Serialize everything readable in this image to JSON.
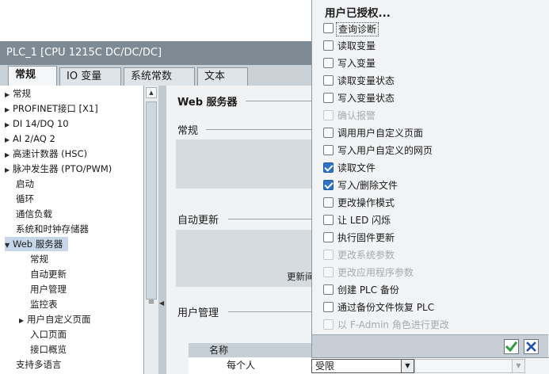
{
  "window": {
    "title": "PLC_1 [CPU 1215C DC/DC/DC]",
    "tabs": [
      "常规",
      "IO 变量",
      "系统常数",
      "文本"
    ]
  },
  "tree": {
    "items": [
      {
        "label": "常规",
        "arrow": "▶"
      },
      {
        "label": "PROFINET接口 [X1]",
        "arrow": "▶"
      },
      {
        "label": "DI 14/DQ 10",
        "arrow": "▶"
      },
      {
        "label": "AI 2/AQ 2",
        "arrow": "▶"
      },
      {
        "label": "高速计数器 (HSC)",
        "arrow": "▶"
      },
      {
        "label": "脉冲发生器 (PTO/PWM)",
        "arrow": "▶"
      },
      {
        "label": "启动",
        "arrow": ""
      },
      {
        "label": "循环",
        "arrow": ""
      },
      {
        "label": "通信负载",
        "arrow": ""
      },
      {
        "label": "系统和时钟存储器",
        "arrow": ""
      },
      {
        "label": "Web 服务器",
        "arrow": "▼"
      },
      {
        "label": "常规",
        "arrow": ""
      },
      {
        "label": "自动更新",
        "arrow": ""
      },
      {
        "label": "用户管理",
        "arrow": ""
      },
      {
        "label": "监控表",
        "arrow": ""
      },
      {
        "label": "用户自定义页面",
        "arrow": "▶"
      },
      {
        "label": "入口页面",
        "arrow": ""
      },
      {
        "label": "接口概览",
        "arrow": ""
      },
      {
        "label": "支持多语言",
        "arrow": ""
      }
    ]
  },
  "content": {
    "section_title": "Web 服务器",
    "general": "常规",
    "auto_update": "自动更新",
    "update_partial": "更新间",
    "user_management": "用户管理",
    "table_col_name": "名称",
    "table_row_name": "每个人"
  },
  "popup": {
    "title": "用户已授权...",
    "permissions": [
      {
        "label": "查询诊断",
        "checked": false,
        "disabled": false
      },
      {
        "label": "读取变量",
        "checked": false,
        "disabled": false
      },
      {
        "label": "写入变量",
        "checked": false,
        "disabled": false
      },
      {
        "label": "读取变量状态",
        "checked": false,
        "disabled": false
      },
      {
        "label": "写入变量状态",
        "checked": false,
        "disabled": false
      },
      {
        "label": "确认报警",
        "checked": false,
        "disabled": true
      },
      {
        "label": "调用用户自定义页面",
        "checked": false,
        "disabled": false
      },
      {
        "label": "写入用户自定义的网页",
        "checked": false,
        "disabled": false
      },
      {
        "label": "读取文件",
        "checked": true,
        "disabled": false
      },
      {
        "label": "写入/删除文件",
        "checked": true,
        "disabled": false
      },
      {
        "label": "更改操作模式",
        "checked": false,
        "disabled": false
      },
      {
        "label": "让 LED 闪烁",
        "checked": false,
        "disabled": false
      },
      {
        "label": "执行固件更新",
        "checked": false,
        "disabled": false
      },
      {
        "label": "更改系统参数",
        "checked": false,
        "disabled": true
      },
      {
        "label": "更改应用程序参数",
        "checked": false,
        "disabled": true
      },
      {
        "label": "创建 PLC 备份",
        "checked": false,
        "disabled": false
      },
      {
        "label": "通过备份文件恢复 PLC",
        "checked": false,
        "disabled": false
      },
      {
        "label": "以 F-Admin 角色进行更改",
        "checked": false,
        "disabled": true
      }
    ]
  },
  "dropdown": {
    "value": "受限"
  },
  "colors": {
    "title_bar": "#7e8a93",
    "check_accent": "#2e73c4",
    "ok_green": "#2e9a3a",
    "cancel_blue": "#1f4fb0"
  }
}
